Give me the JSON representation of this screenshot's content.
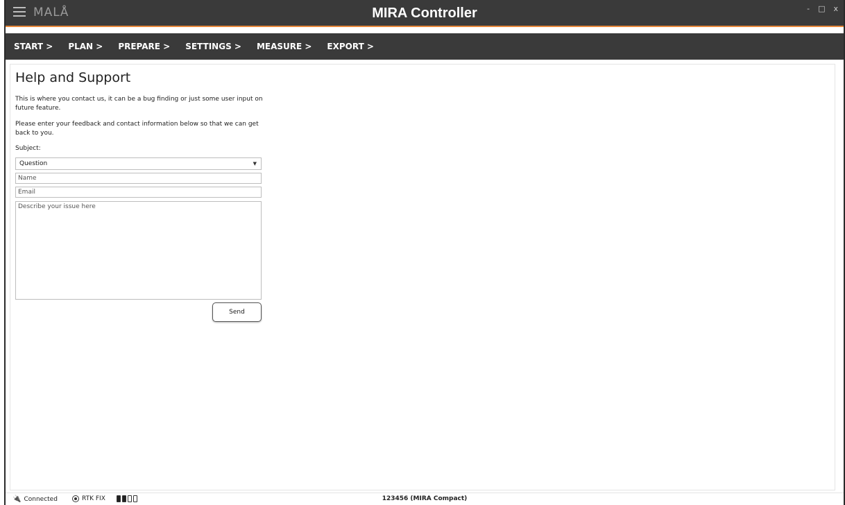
{
  "window": {
    "title": "MIRA Controller",
    "logo": "MALÅ",
    "controls": [
      "-",
      "□",
      "x"
    ]
  },
  "nav": {
    "items": [
      "START >",
      "PLAN >",
      "PREPARE >",
      "SETTINGS >",
      "MEASURE >",
      "EXPORT >"
    ]
  },
  "help": {
    "title": "Help and Support",
    "intro": "This is where you contact us, it can be a bug finding or just some user input on future feature.",
    "instructions": "Please enter your feedback and contact information below so that we can get back to you.",
    "subject_label": "Subject:",
    "subject_value": "Question",
    "name_placeholder": "Name",
    "email_placeholder": "Email",
    "issue_placeholder": "Describe your issue here",
    "send_label": "Send"
  },
  "status": {
    "connection": "Connected",
    "gps": "RTK FIX",
    "device": "123456 (MIRA Compact)",
    "batteries_full": 2,
    "batteries_total": 4
  },
  "colors": {
    "titlebar_bg": "#3a3a3a",
    "accent": "#e8883a"
  },
  "icons": {
    "menu": "hamburger-icon",
    "connection": "plug-icon",
    "gps": "target-icon",
    "battery": "battery-icon",
    "dropdown": "caret-down-icon"
  }
}
